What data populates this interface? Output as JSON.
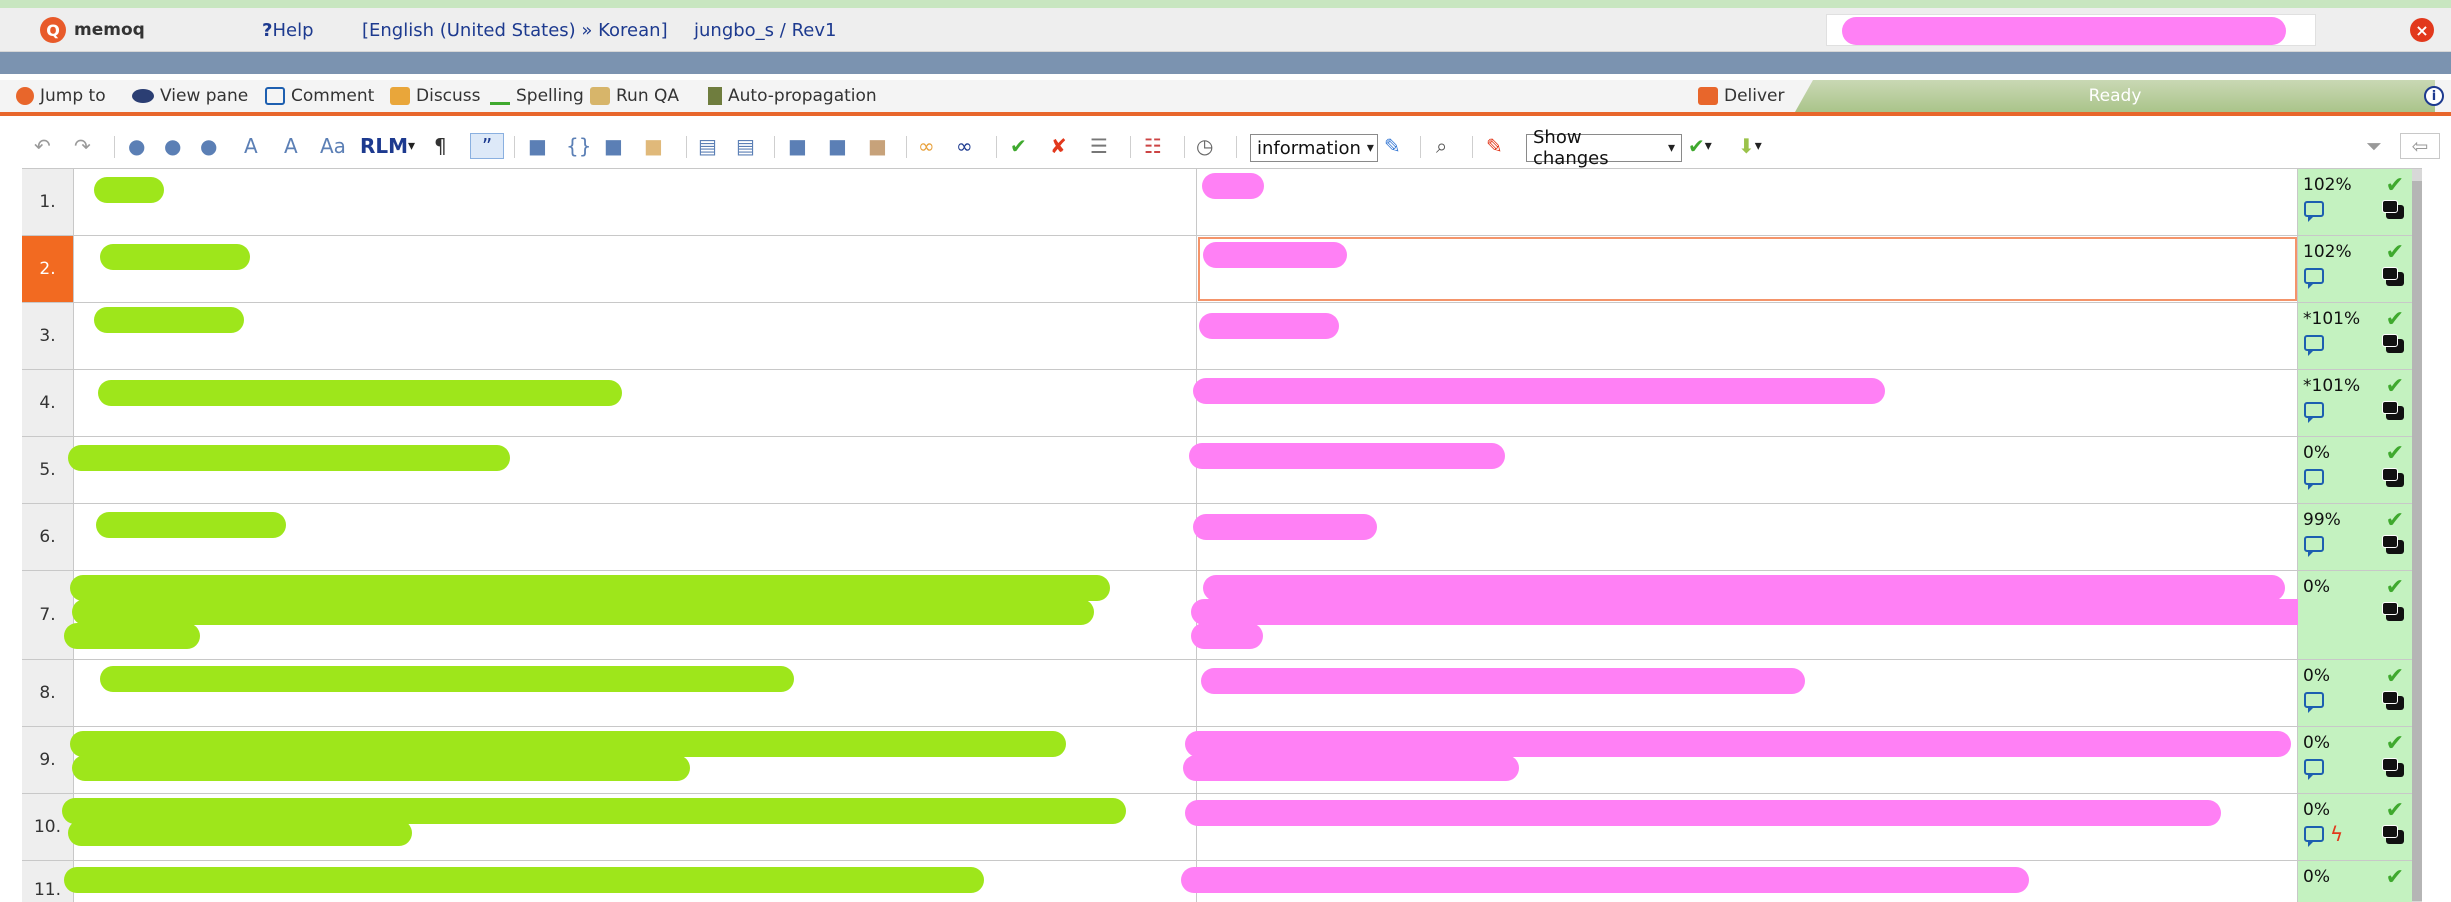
{
  "app": {
    "logo_glyph": "Q",
    "name": "memoq"
  },
  "titlebar": {
    "help_label": "Help",
    "language_pair": "[English (United States) » Korean]",
    "project": "jungbo_s / Rev1"
  },
  "ribbon": {
    "jump_to": "Jump to",
    "view_pane": "View pane",
    "comment": "Comment",
    "discuss": "Discuss",
    "spelling": "Spelling",
    "run_qa": "Run QA",
    "auto_propagation": "Auto-propagation",
    "deliver": "Deliver",
    "status": "Ready"
  },
  "toolbar": {
    "rlm_label": "RLM",
    "severity_select": "information",
    "changes_select": "Show changes"
  },
  "segments": [
    {
      "num": "1.",
      "match": "102%"
    },
    {
      "num": "2.",
      "match": "102%"
    },
    {
      "num": "3.",
      "match": "*101%"
    },
    {
      "num": "4.",
      "match": "*101%"
    },
    {
      "num": "5.",
      "match": "0%"
    },
    {
      "num": "6.",
      "match": "99%"
    },
    {
      "num": "7.",
      "match": "0%"
    },
    {
      "num": "8.",
      "match": "0%"
    },
    {
      "num": "9.",
      "match": "0%"
    },
    {
      "num": "10.",
      "match": "0%"
    },
    {
      "num": "11.",
      "match": "0%"
    }
  ],
  "colors": {
    "accent": "#e8662b",
    "active_row": "#f26a21",
    "meta_bg": "#c4f2c0",
    "redaction_source": "#9ee61b",
    "redaction_target": "#ff80f5"
  }
}
